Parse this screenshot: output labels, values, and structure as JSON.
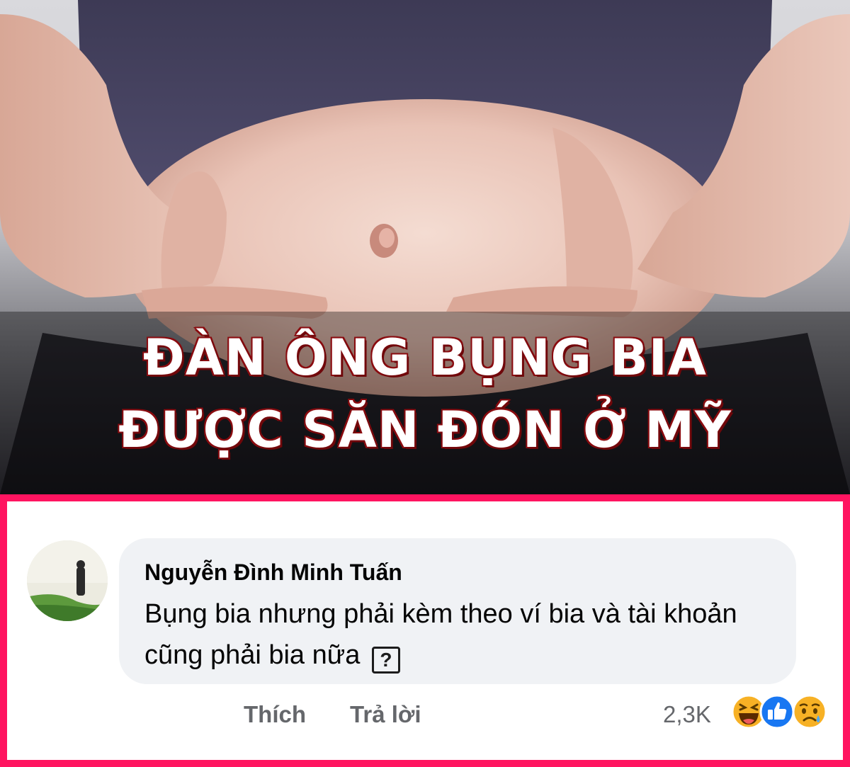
{
  "post": {
    "headline_line1": "ĐÀN ÔNG BỤNG BIA",
    "headline_line2": "ĐƯỢC SĂN ĐÓN Ở MỸ"
  },
  "comment": {
    "author": "Nguyễn Đình Minh Tuấn",
    "text": "Bụng bia nhưng phải kèm theo ví bia và tài khoản cũng phải bia nữa",
    "emoji_placeholder": "?",
    "like_label": "Thích",
    "reply_label": "Trả lời",
    "reaction_count": "2,3K",
    "reactions": [
      "haha-icon",
      "like-icon",
      "sad-icon"
    ]
  },
  "colors": {
    "frame_border": "#ff1460",
    "headline_fill": "#ffffff",
    "headline_stroke": "#8a0c10",
    "bubble_bg": "#f0f2f5",
    "secondary_text": "#65676b",
    "like_blue": "#1877f2"
  }
}
